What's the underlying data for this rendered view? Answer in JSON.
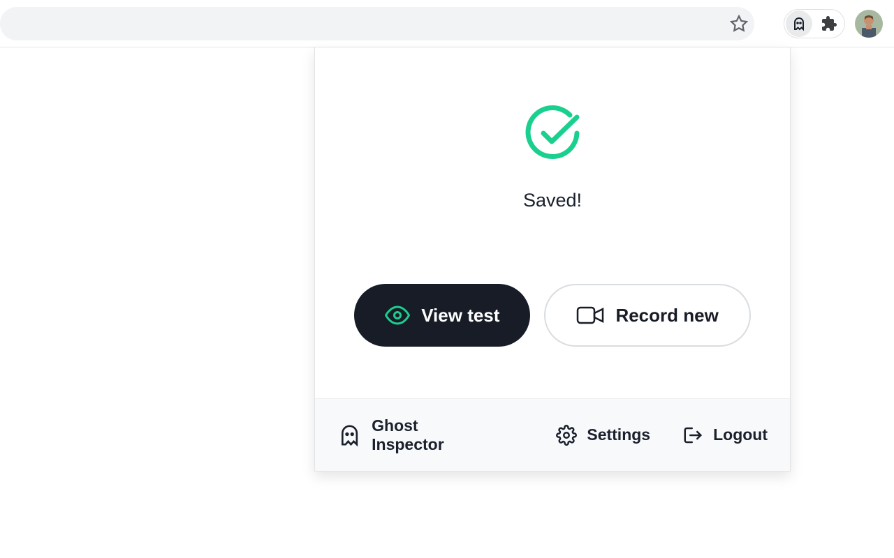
{
  "colors": {
    "accent": "#1bcf8f",
    "dark": "#171c26"
  },
  "popup": {
    "status_text": "Saved!",
    "buttons": {
      "view_test": "View test",
      "record_new": "Record new"
    },
    "footer": {
      "brand": "Ghost Inspector",
      "settings": "Settings",
      "logout": "Logout"
    }
  }
}
